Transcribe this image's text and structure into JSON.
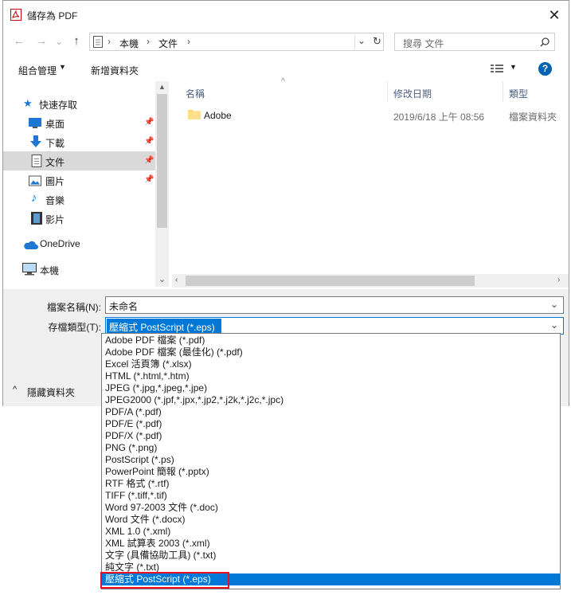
{
  "window": {
    "title": "儲存為 PDF"
  },
  "nav": {
    "back": "←",
    "forward": "→",
    "recent": "⌄",
    "up": "↑",
    "breadcrumb": [
      "本機",
      "文件"
    ],
    "search_placeholder": "搜尋 文件"
  },
  "toolbar": {
    "organize": "組合管理",
    "new_folder": "新增資料夾"
  },
  "sidebar": {
    "items": [
      {
        "label": "快速存取",
        "icon": "star-icon"
      },
      {
        "label": "桌面",
        "icon": "desktop-icon"
      },
      {
        "label": "下載",
        "icon": "download-icon"
      },
      {
        "label": "文件",
        "icon": "document-icon"
      },
      {
        "label": "圖片",
        "icon": "picture-icon"
      },
      {
        "label": "音樂",
        "icon": "music-icon"
      },
      {
        "label": "影片",
        "icon": "video-icon"
      },
      {
        "label": "OneDrive",
        "icon": "cloud-icon"
      },
      {
        "label": "本機",
        "icon": "computer-icon"
      }
    ]
  },
  "columns": {
    "name": "名稱",
    "modified": "修改日期",
    "type": "類型"
  },
  "files": [
    {
      "name": "Adobe",
      "modified": "2019/6/18 上午 08:56",
      "type": "檔案資料夾"
    }
  ],
  "form": {
    "filename_label": "檔案名稱(N):",
    "filename_value": "未命名",
    "filetype_label": "存檔類型(T):",
    "filetype_value": "壓縮式 PostScript (*.eps)",
    "hide_folders": "隱藏資料夾"
  },
  "filetype_options": [
    "Adobe PDF 檔案 (*.pdf)",
    "Adobe PDF 檔案 (最佳化) (*.pdf)",
    "Excel 活頁簿 (*.xlsx)",
    "HTML (*.html,*.htm)",
    "JPEG (*.jpg,*.jpeg,*.jpe)",
    "JPEG2000 (*.jpf,*.jpx,*.jp2,*.j2k,*.j2c,*.jpc)",
    "PDF/A (*.pdf)",
    "PDF/E (*.pdf)",
    "PDF/X (*.pdf)",
    "PNG (*.png)",
    "PostScript (*.ps)",
    "PowerPoint 簡報 (*.pptx)",
    "RTF 格式 (*.rtf)",
    "TIFF (*.tiff,*.tif)",
    "Word 97-2003 文件 (*.doc)",
    "Word 文件 (*.docx)",
    "XML 1.0 (*.xml)",
    "XML 試算表 2003 (*.xml)",
    "文字 (具備協助工具) (*.txt)",
    "純文字 (*.txt)",
    "壓縮式 PostScript (*.eps)"
  ],
  "colors": {
    "accent": "#0078d7",
    "selected_bg": "#cce8ff",
    "highlight_box": "#e81123"
  }
}
